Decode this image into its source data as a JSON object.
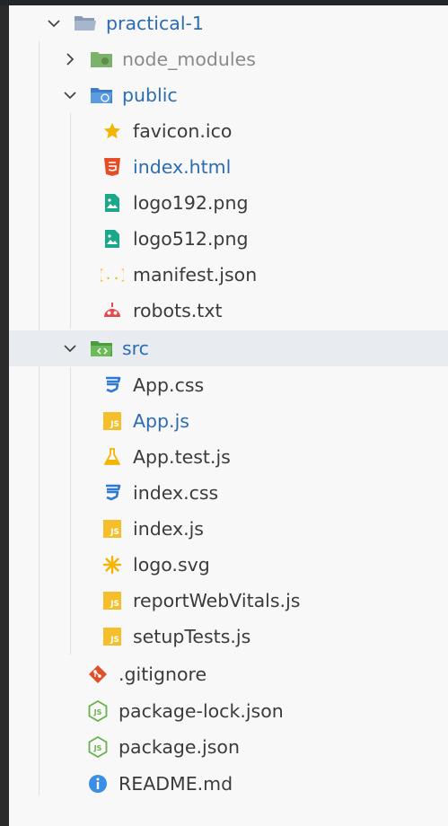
{
  "explorer": {
    "root": {
      "name": "practical-1",
      "status": ""
    },
    "node_modules": {
      "name": "node_modules"
    },
    "public": {
      "name": "public",
      "files": [
        {
          "name": "favicon.ico",
          "icon": "star-icon",
          "status": ""
        },
        {
          "name": "index.html",
          "icon": "html5-icon",
          "status": "M"
        },
        {
          "name": "logo192.png",
          "icon": "image-icon",
          "status": ""
        },
        {
          "name": "logo512.png",
          "icon": "image-icon",
          "status": ""
        },
        {
          "name": "manifest.json",
          "icon": "json-braces-icon",
          "status": ""
        },
        {
          "name": "robots.txt",
          "icon": "robot-icon",
          "status": ""
        }
      ]
    },
    "src": {
      "name": "src",
      "files": [
        {
          "name": "App.css",
          "icon": "css3-icon",
          "status": ""
        },
        {
          "name": "App.js",
          "icon": "js-icon",
          "status": "M"
        },
        {
          "name": "App.test.js",
          "icon": "flask-icon",
          "status": ""
        },
        {
          "name": "index.css",
          "icon": "css3-icon",
          "status": ""
        },
        {
          "name": "index.js",
          "icon": "js-icon",
          "status": ""
        },
        {
          "name": "logo.svg",
          "icon": "svg-asterisk-icon",
          "status": ""
        },
        {
          "name": "reportWebVitals.js",
          "icon": "js-icon",
          "status": ""
        },
        {
          "name": "setupTests.js",
          "icon": "js-icon",
          "status": ""
        }
      ]
    },
    "root_files": [
      {
        "name": ".gitignore",
        "icon": "git-icon"
      },
      {
        "name": "package-lock.json",
        "icon": "nodejs-icon"
      },
      {
        "name": "package.json",
        "icon": "nodejs-icon"
      },
      {
        "name": "README.md",
        "icon": "info-icon"
      }
    ],
    "colors": {
      "modified_text": "#2c6cb0",
      "folder_blue": "#3d7cc9",
      "folder_green": "#59a44a",
      "html_orange": "#e44d26",
      "js_yellow": "#f4bf2a",
      "css_blue": "#2f7bd3",
      "image_teal": "#1aa88a",
      "robot_red": "#e5484d",
      "git_red": "#e14e2a",
      "node_green": "#6ab04c",
      "info_blue": "#3b8ee6"
    }
  }
}
